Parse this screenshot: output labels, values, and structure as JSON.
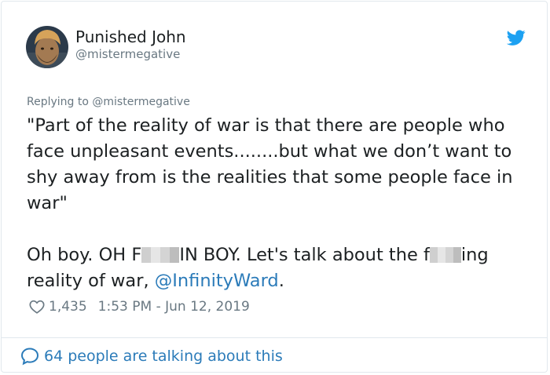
{
  "tweet": {
    "author_name": "Punished John",
    "author_handle": "@mistermegative",
    "replying_prefix": "Replying to ",
    "replying_handle": "@mistermegative",
    "quote_text": "\"Part of the reality of war is that there are people who face unpleasant events........but what we don’t want to shy away from is the realities that some people face in war\"",
    "line2_part1": "Oh boy. OH F",
    "line2_part2": "IN BOY. Let's talk about the f",
    "line2_part3": "ing reality of war, ",
    "mention_link": "@InfinityWard",
    "line2_end": ".",
    "like_count": "1,435",
    "timestamp": "1:53 PM - Jun 12, 2019"
  },
  "footer": {
    "conversation_label": "64 people are talking about this"
  },
  "colors": {
    "link": "#2b7bb9",
    "twitter_blue": "#1da1f2",
    "muted": "#697882"
  },
  "icons": {
    "bird": "twitter-bird-icon",
    "heart": "heart-icon",
    "bubble": "speech-bubble-icon"
  }
}
